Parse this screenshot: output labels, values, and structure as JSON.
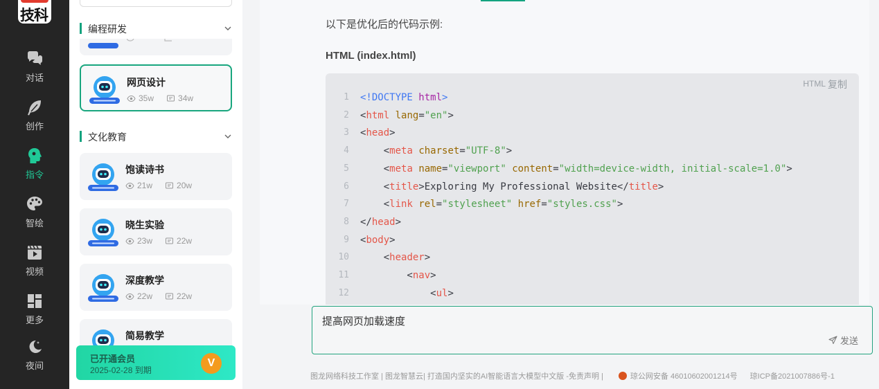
{
  "logo": {
    "text": "技科"
  },
  "rail": [
    {
      "label": "对话",
      "icon": "chat-icon",
      "active": false
    },
    {
      "label": "创作",
      "icon": "feather-icon",
      "active": false
    },
    {
      "label": "指令",
      "icon": "head-icon",
      "active": true
    },
    {
      "label": "智绘",
      "icon": "palette-icon",
      "active": false
    },
    {
      "label": "视频",
      "icon": "video-icon",
      "active": false
    },
    {
      "label": "更多",
      "icon": "grid-icon",
      "active": false
    },
    {
      "label": "夜间",
      "icon": "moon-icon",
      "active": false
    }
  ],
  "panel": {
    "categories": [
      {
        "label": "编程研发"
      },
      {
        "label": "文化教育"
      }
    ],
    "cards": [
      {
        "name": "网页设计",
        "views": "35w",
        "comments": "34w",
        "selected": true
      },
      {
        "name": "饱读诗书",
        "views": "21w",
        "comments": "20w",
        "selected": false
      },
      {
        "name": "晓生实验",
        "views": "23w",
        "comments": "22w",
        "selected": false
      },
      {
        "name": "深度教学",
        "views": "22w",
        "comments": "22w",
        "selected": false
      },
      {
        "name": "简易教学",
        "views": "",
        "comments": "",
        "selected": false
      }
    ],
    "vip": {
      "title": "已开通会员",
      "expiry": "2025-02-28 到期",
      "badge": "V"
    }
  },
  "main": {
    "intro": "以下是优化后的代码示例:",
    "heading": "HTML (index.html)",
    "code": {
      "lang": "HTML",
      "copy": "复制",
      "lines": [
        "<!DOCTYPE html>",
        "<html lang=\"en\">",
        "<head>",
        "    <meta charset=\"UTF-8\">",
        "    <meta name=\"viewport\" content=\"width=device-width, initial-scale=1.0\">",
        "    <title>Exploring My Professional Website</title>",
        "    <link rel=\"stylesheet\" href=\"styles.css\">",
        "</head>",
        "<body>",
        "    <header>",
        "        <nav>",
        "            <ul>"
      ]
    }
  },
  "composer": {
    "value": "提高网页加载速度",
    "send": "发送"
  },
  "footer": {
    "left": "图龙网络科技工作室 | 图龙智慧云| 打造国内坚实的AI智能语言大模型中文版 -免责声明 |",
    "police": "琼公网安备 46010602001214号",
    "icp": "琼ICP备2021007886号-1"
  },
  "colors": {
    "accent": "#14a37f",
    "rail_bg": "#252525",
    "vip_start": "#21d6a4",
    "vip_badge": "#f49b1e"
  }
}
